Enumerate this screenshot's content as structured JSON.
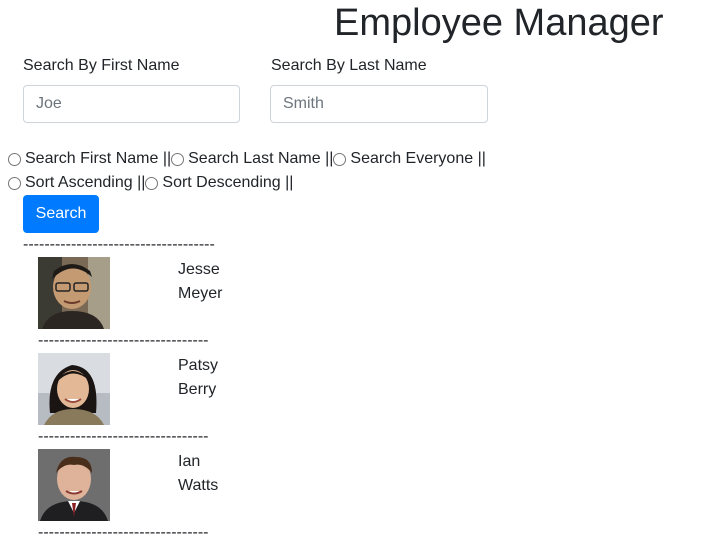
{
  "header": {
    "title": "Employee Manager"
  },
  "search": {
    "first_label": "Search By First Name",
    "first_placeholder": "Joe",
    "last_label": "Search By Last Name",
    "last_placeholder": "Smith"
  },
  "options": {
    "row1": [
      {
        "label": "Search First Name ||"
      },
      {
        "label": "Search Last Name ||"
      },
      {
        "label": "Search Everyone ||"
      }
    ],
    "row2": [
      {
        "label": "Sort Ascending ||"
      },
      {
        "label": "Sort Descending ||"
      }
    ]
  },
  "actions": {
    "search_label": "Search"
  },
  "dividers": {
    "top": "------------------------------------",
    "item": "--------------------------------"
  },
  "employees": [
    {
      "first": "Jesse",
      "last": "Meyer"
    },
    {
      "first": "Patsy",
      "last": "Berry"
    },
    {
      "first": "Ian",
      "last": "Watts"
    }
  ],
  "colors": {
    "primary": "#007bff",
    "text": "#212529",
    "input_border": "#ced4da"
  }
}
